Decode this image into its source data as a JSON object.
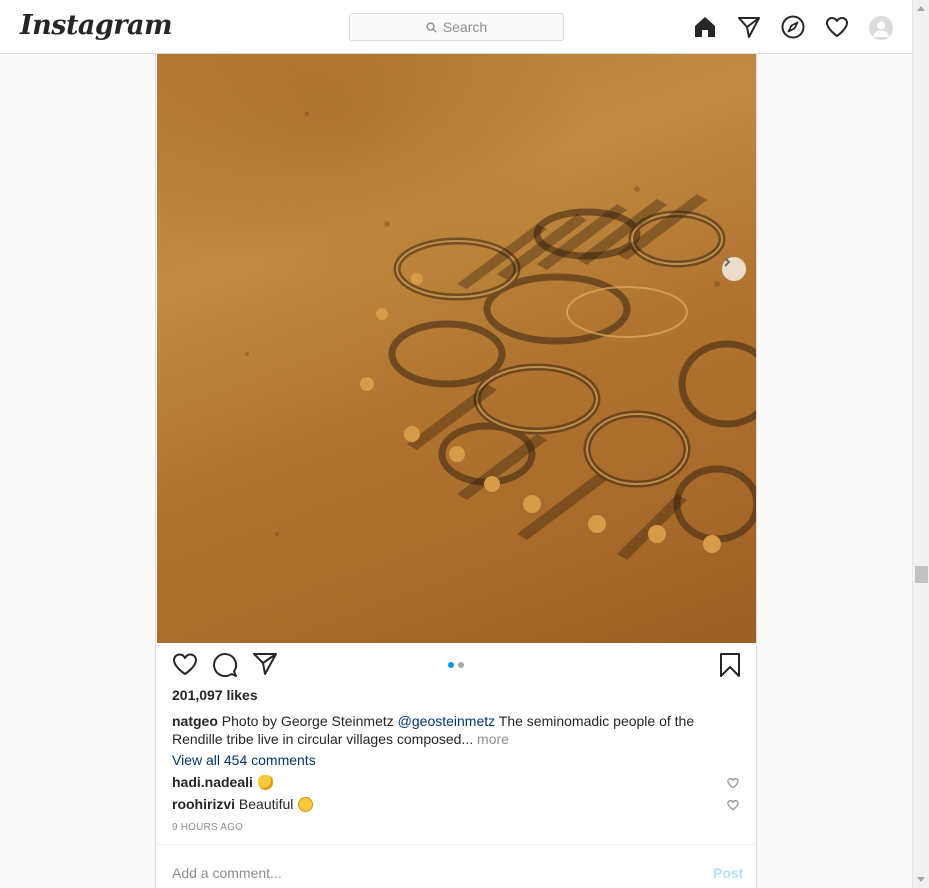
{
  "nav": {
    "logo": "Instagram",
    "search_placeholder": "Search",
    "icons": [
      "home-icon",
      "direct-icon",
      "explore-icon",
      "activity-heart-icon",
      "profile-avatar"
    ]
  },
  "post": {
    "likes": "201,097 likes",
    "caption": {
      "username": "natgeo",
      "text_before": " Photo by George Steinmetz ",
      "mention": "@geosteinmetz",
      "text_after": " The seminomadic people of the Rendille tribe live in circular villages composed...",
      "more": "more"
    },
    "view_all_comments": "View all 454 comments",
    "comments": [
      {
        "username": "hadi.nadeali",
        "text": "",
        "emoji": "clapping-hands"
      },
      {
        "username": "roohirizvi",
        "text": "Beautiful",
        "emoji": "thinking-face"
      }
    ],
    "time": "9 HOURS AGO",
    "add_comment_placeholder": "Add a comment...",
    "post_button": "Post",
    "carousel": {
      "total": 2,
      "active": 1
    }
  },
  "colors": {
    "accent_blue": "#0095f6",
    "link": "#00376b",
    "muted": "#8e8e8e",
    "post_disabled": "#b2dffc"
  }
}
